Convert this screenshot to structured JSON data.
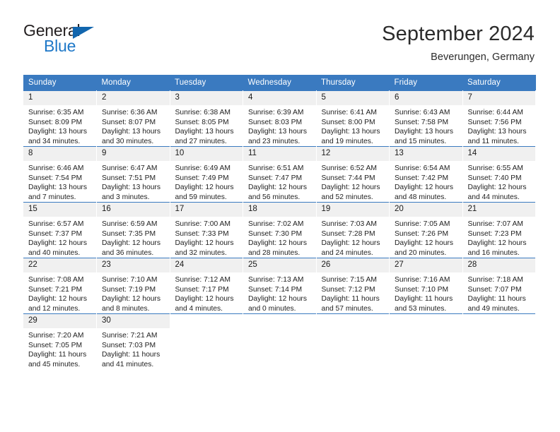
{
  "brand": {
    "name_part1": "General",
    "name_part2": "Blue"
  },
  "header": {
    "title": "September 2024",
    "location": "Beverungen, Germany"
  },
  "colors": {
    "header_blue": "#3a7ac0",
    "logo_blue": "#1e78c8",
    "daynum_bg": "#f0f0f0"
  },
  "calendar": {
    "weekdays": [
      "Sunday",
      "Monday",
      "Tuesday",
      "Wednesday",
      "Thursday",
      "Friday",
      "Saturday"
    ],
    "weeks": [
      [
        {
          "day": "1",
          "sunrise": "Sunrise: 6:35 AM",
          "sunset": "Sunset: 8:09 PM",
          "daylight1": "Daylight: 13 hours",
          "daylight2": "and 34 minutes."
        },
        {
          "day": "2",
          "sunrise": "Sunrise: 6:36 AM",
          "sunset": "Sunset: 8:07 PM",
          "daylight1": "Daylight: 13 hours",
          "daylight2": "and 30 minutes."
        },
        {
          "day": "3",
          "sunrise": "Sunrise: 6:38 AM",
          "sunset": "Sunset: 8:05 PM",
          "daylight1": "Daylight: 13 hours",
          "daylight2": "and 27 minutes."
        },
        {
          "day": "4",
          "sunrise": "Sunrise: 6:39 AM",
          "sunset": "Sunset: 8:03 PM",
          "daylight1": "Daylight: 13 hours",
          "daylight2": "and 23 minutes."
        },
        {
          "day": "5",
          "sunrise": "Sunrise: 6:41 AM",
          "sunset": "Sunset: 8:00 PM",
          "daylight1": "Daylight: 13 hours",
          "daylight2": "and 19 minutes."
        },
        {
          "day": "6",
          "sunrise": "Sunrise: 6:43 AM",
          "sunset": "Sunset: 7:58 PM",
          "daylight1": "Daylight: 13 hours",
          "daylight2": "and 15 minutes."
        },
        {
          "day": "7",
          "sunrise": "Sunrise: 6:44 AM",
          "sunset": "Sunset: 7:56 PM",
          "daylight1": "Daylight: 13 hours",
          "daylight2": "and 11 minutes."
        }
      ],
      [
        {
          "day": "8",
          "sunrise": "Sunrise: 6:46 AM",
          "sunset": "Sunset: 7:54 PM",
          "daylight1": "Daylight: 13 hours",
          "daylight2": "and 7 minutes."
        },
        {
          "day": "9",
          "sunrise": "Sunrise: 6:47 AM",
          "sunset": "Sunset: 7:51 PM",
          "daylight1": "Daylight: 13 hours",
          "daylight2": "and 3 minutes."
        },
        {
          "day": "10",
          "sunrise": "Sunrise: 6:49 AM",
          "sunset": "Sunset: 7:49 PM",
          "daylight1": "Daylight: 12 hours",
          "daylight2": "and 59 minutes."
        },
        {
          "day": "11",
          "sunrise": "Sunrise: 6:51 AM",
          "sunset": "Sunset: 7:47 PM",
          "daylight1": "Daylight: 12 hours",
          "daylight2": "and 56 minutes."
        },
        {
          "day": "12",
          "sunrise": "Sunrise: 6:52 AM",
          "sunset": "Sunset: 7:44 PM",
          "daylight1": "Daylight: 12 hours",
          "daylight2": "and 52 minutes."
        },
        {
          "day": "13",
          "sunrise": "Sunrise: 6:54 AM",
          "sunset": "Sunset: 7:42 PM",
          "daylight1": "Daylight: 12 hours",
          "daylight2": "and 48 minutes."
        },
        {
          "day": "14",
          "sunrise": "Sunrise: 6:55 AM",
          "sunset": "Sunset: 7:40 PM",
          "daylight1": "Daylight: 12 hours",
          "daylight2": "and 44 minutes."
        }
      ],
      [
        {
          "day": "15",
          "sunrise": "Sunrise: 6:57 AM",
          "sunset": "Sunset: 7:37 PM",
          "daylight1": "Daylight: 12 hours",
          "daylight2": "and 40 minutes."
        },
        {
          "day": "16",
          "sunrise": "Sunrise: 6:59 AM",
          "sunset": "Sunset: 7:35 PM",
          "daylight1": "Daylight: 12 hours",
          "daylight2": "and 36 minutes."
        },
        {
          "day": "17",
          "sunrise": "Sunrise: 7:00 AM",
          "sunset": "Sunset: 7:33 PM",
          "daylight1": "Daylight: 12 hours",
          "daylight2": "and 32 minutes."
        },
        {
          "day": "18",
          "sunrise": "Sunrise: 7:02 AM",
          "sunset": "Sunset: 7:30 PM",
          "daylight1": "Daylight: 12 hours",
          "daylight2": "and 28 minutes."
        },
        {
          "day": "19",
          "sunrise": "Sunrise: 7:03 AM",
          "sunset": "Sunset: 7:28 PM",
          "daylight1": "Daylight: 12 hours",
          "daylight2": "and 24 minutes."
        },
        {
          "day": "20",
          "sunrise": "Sunrise: 7:05 AM",
          "sunset": "Sunset: 7:26 PM",
          "daylight1": "Daylight: 12 hours",
          "daylight2": "and 20 minutes."
        },
        {
          "day": "21",
          "sunrise": "Sunrise: 7:07 AM",
          "sunset": "Sunset: 7:23 PM",
          "daylight1": "Daylight: 12 hours",
          "daylight2": "and 16 minutes."
        }
      ],
      [
        {
          "day": "22",
          "sunrise": "Sunrise: 7:08 AM",
          "sunset": "Sunset: 7:21 PM",
          "daylight1": "Daylight: 12 hours",
          "daylight2": "and 12 minutes."
        },
        {
          "day": "23",
          "sunrise": "Sunrise: 7:10 AM",
          "sunset": "Sunset: 7:19 PM",
          "daylight1": "Daylight: 12 hours",
          "daylight2": "and 8 minutes."
        },
        {
          "day": "24",
          "sunrise": "Sunrise: 7:12 AM",
          "sunset": "Sunset: 7:17 PM",
          "daylight1": "Daylight: 12 hours",
          "daylight2": "and 4 minutes."
        },
        {
          "day": "25",
          "sunrise": "Sunrise: 7:13 AM",
          "sunset": "Sunset: 7:14 PM",
          "daylight1": "Daylight: 12 hours",
          "daylight2": "and 0 minutes."
        },
        {
          "day": "26",
          "sunrise": "Sunrise: 7:15 AM",
          "sunset": "Sunset: 7:12 PM",
          "daylight1": "Daylight: 11 hours",
          "daylight2": "and 57 minutes."
        },
        {
          "day": "27",
          "sunrise": "Sunrise: 7:16 AM",
          "sunset": "Sunset: 7:10 PM",
          "daylight1": "Daylight: 11 hours",
          "daylight2": "and 53 minutes."
        },
        {
          "day": "28",
          "sunrise": "Sunrise: 7:18 AM",
          "sunset": "Sunset: 7:07 PM",
          "daylight1": "Daylight: 11 hours",
          "daylight2": "and 49 minutes."
        }
      ],
      [
        {
          "day": "29",
          "sunrise": "Sunrise: 7:20 AM",
          "sunset": "Sunset: 7:05 PM",
          "daylight1": "Daylight: 11 hours",
          "daylight2": "and 45 minutes."
        },
        {
          "day": "30",
          "sunrise": "Sunrise: 7:21 AM",
          "sunset": "Sunset: 7:03 PM",
          "daylight1": "Daylight: 11 hours",
          "daylight2": "and 41 minutes."
        },
        {
          "day": "",
          "sunrise": "",
          "sunset": "",
          "daylight1": "",
          "daylight2": ""
        },
        {
          "day": "",
          "sunrise": "",
          "sunset": "",
          "daylight1": "",
          "daylight2": ""
        },
        {
          "day": "",
          "sunrise": "",
          "sunset": "",
          "daylight1": "",
          "daylight2": ""
        },
        {
          "day": "",
          "sunrise": "",
          "sunset": "",
          "daylight1": "",
          "daylight2": ""
        },
        {
          "day": "",
          "sunrise": "",
          "sunset": "",
          "daylight1": "",
          "daylight2": ""
        }
      ]
    ]
  }
}
